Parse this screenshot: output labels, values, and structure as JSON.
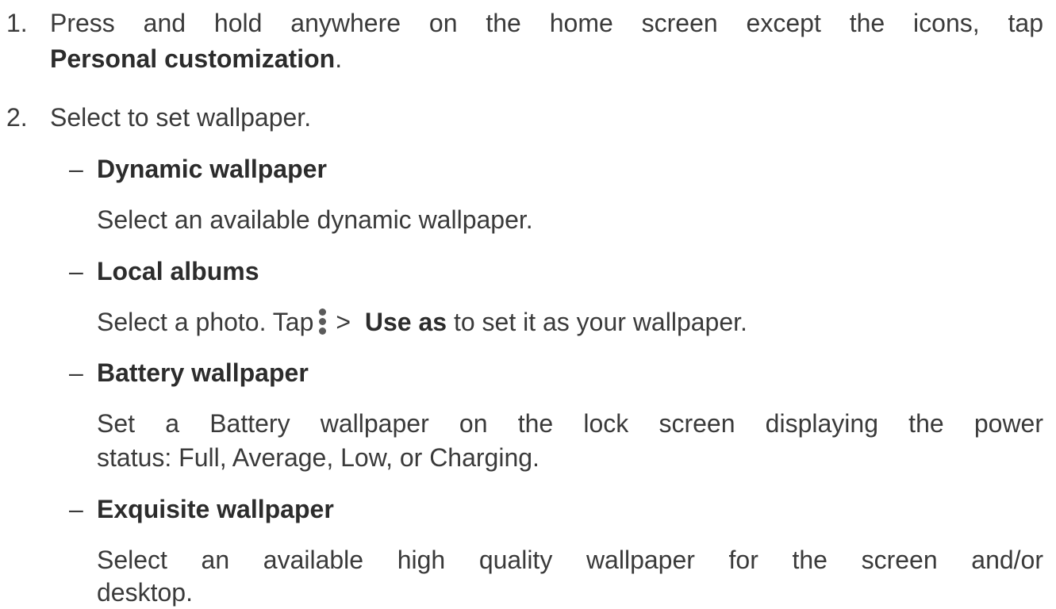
{
  "steps": [
    {
      "number": "1.",
      "text_line1": "Press and hold anywhere on the home screen except the icons, tap",
      "bold": "Personal customization",
      "suffix": "."
    },
    {
      "number": "2.",
      "text": "Select to set wallpaper."
    }
  ],
  "options": [
    {
      "bullet": "–",
      "title": "Dynamic wallpaper",
      "description": "Select an available dynamic wallpaper."
    },
    {
      "bullet": "–",
      "title": "Local albums",
      "description_pre": "Select a photo. Tap",
      "menu_icon": "more-vertical-icon",
      "arrow": ">",
      "bold": "Use as",
      "description_post": "to set it as your wallpaper."
    },
    {
      "bullet": "–",
      "title": "Battery wallpaper",
      "description_line1": "Set a Battery wallpaper on the lock screen displaying the power",
      "description_line2": "status: Full, Average, Low, or Charging."
    },
    {
      "bullet": "–",
      "title": "Exquisite wallpaper",
      "description_line1": "Select an available high quality wallpaper for the screen and/or",
      "description_line2": "desktop."
    }
  ]
}
